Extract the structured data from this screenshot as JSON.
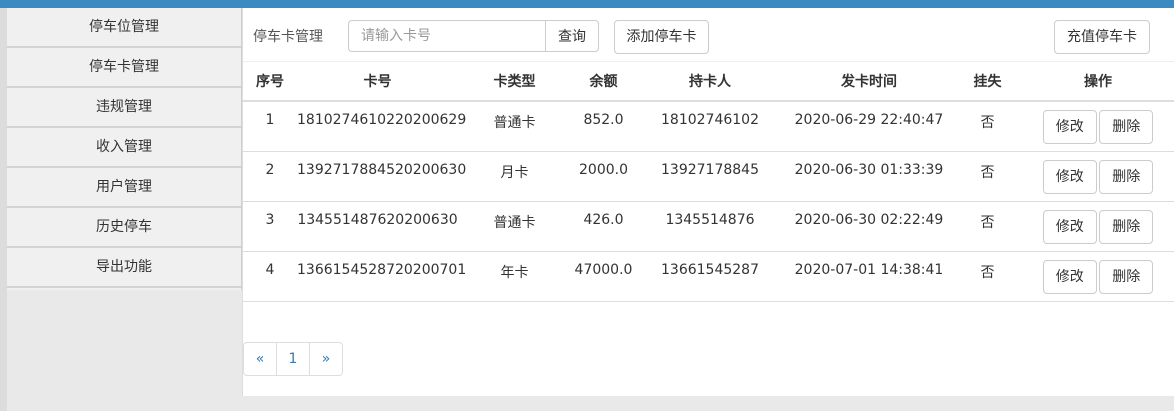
{
  "sidebar": {
    "items": [
      "停车位管理",
      "停车卡管理",
      "违规管理",
      "收入管理",
      "用户管理",
      "历史停车",
      "导出功能"
    ]
  },
  "toolbar": {
    "title": "停车卡管理",
    "search_placeholder": "请输入卡号",
    "search_value": "",
    "search_label": "查询",
    "add_label": "添加停车卡",
    "recharge_label": "充值停车卡"
  },
  "table": {
    "headers": [
      "序号",
      "卡号",
      "卡类型",
      "余额",
      "持卡人",
      "发卡时间",
      "挂失",
      "操作"
    ],
    "rows": [
      {
        "no": "1",
        "card": "1810274610220200629",
        "type": "普通卡",
        "balance": "852.0",
        "holder": "18102746102",
        "time": "2020-06-29 22:40:47",
        "lost": "否"
      },
      {
        "no": "2",
        "card": "1392717884520200630",
        "type": "月卡",
        "balance": "2000.0",
        "holder": "13927178845",
        "time": "2020-06-30 01:33:39",
        "lost": "否"
      },
      {
        "no": "3",
        "card": "134551487620200630",
        "type": "普通卡",
        "balance": "426.0",
        "holder": "1345514876",
        "time": "2020-06-30 02:22:49",
        "lost": "否"
      },
      {
        "no": "4",
        "card": "1366154528720200701",
        "type": "年卡",
        "balance": "47000.0",
        "holder": "13661545287",
        "time": "2020-07-01 14:38:41",
        "lost": "否"
      }
    ],
    "edit_label": "修改",
    "delete_label": "删除"
  },
  "pagination": {
    "prev": "«",
    "page": "1",
    "next": "»"
  }
}
